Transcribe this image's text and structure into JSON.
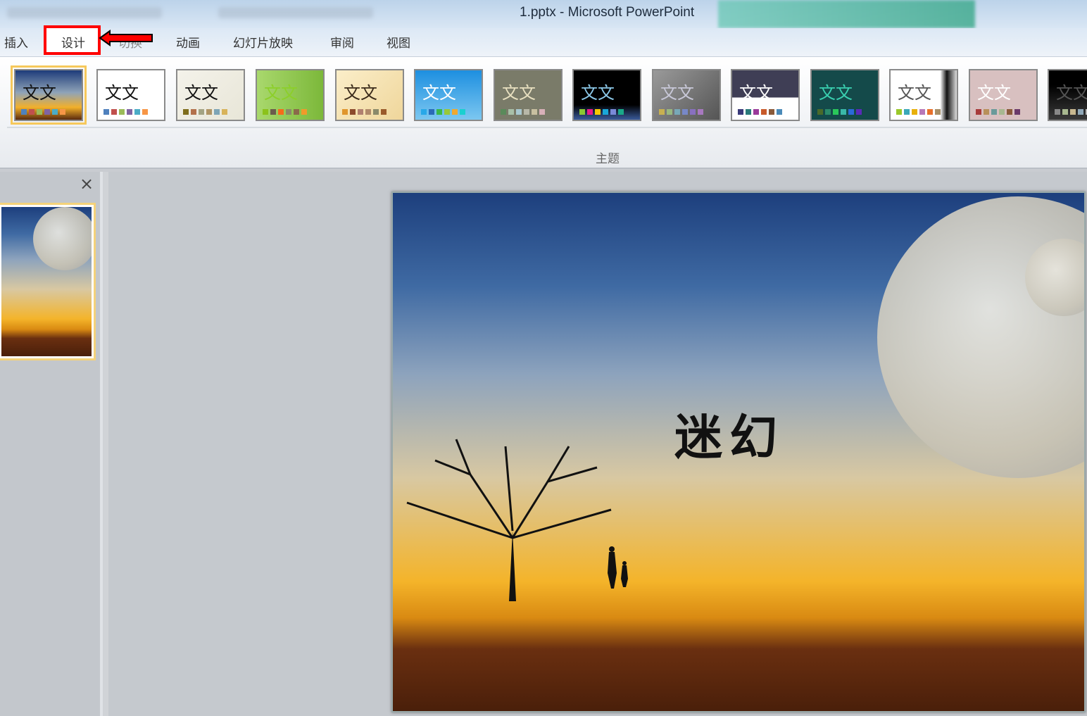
{
  "window": {
    "title": "1.pptx  -  Microsoft PowerPoint"
  },
  "tabs": [
    {
      "label": "插入"
    },
    {
      "label": "设计",
      "active": true
    },
    {
      "label": "切换"
    },
    {
      "label": "动画"
    },
    {
      "label": "幻灯片放映"
    },
    {
      "label": "审阅"
    },
    {
      "label": "视图"
    }
  ],
  "annotation": {
    "highlight_color": "#ff0000"
  },
  "themes": {
    "group_label": "主题",
    "items": [
      {
        "sample": "文文",
        "bg": "linear-gradient(#1e3c7a,#8fa3b8 45%,#f2b02a 75%,#5a2a0e)",
        "color": "#111",
        "swatches": [
          "#4f81bd",
          "#c0504d",
          "#9bbb59",
          "#8064a2",
          "#4bacc6",
          "#f79646"
        ],
        "selected": true
      },
      {
        "sample": "文文",
        "bg": "#fff",
        "color": "#111",
        "swatches": [
          "#4f81bd",
          "#c0504d",
          "#9bbb59",
          "#8064a2",
          "#4bacc6",
          "#f79646"
        ]
      },
      {
        "sample": "文文",
        "bg": "linear-gradient(135deg,#f4f2ea,#e8e6d8)",
        "color": "#111",
        "swatches": [
          "#7f6d1c",
          "#b3714b",
          "#a3a383",
          "#b09565",
          "#7ea5b6",
          "#d8b35a"
        ]
      },
      {
        "sample": "文文",
        "bg": "linear-gradient(90deg,#a9d86d,#7cb83a)",
        "color": "#8ccf2a",
        "swatches": [
          "#8bc21a",
          "#6b5c4c",
          "#f56b1a",
          "#8a8a6a",
          "#8a6a4a",
          "#f19a2a"
        ]
      },
      {
        "sample": "文文",
        "bg": "linear-gradient(135deg,#fbeec9,#efd69b)",
        "color": "#3a2a1a",
        "swatches": [
          "#e0962c",
          "#8c4a2c",
          "#b08070",
          "#b08a6a",
          "#8a8a6a",
          "#9a5a2a"
        ]
      },
      {
        "sample": "文文",
        "bg": "linear-gradient(#1d8fe0,#7cc7f0)",
        "color": "#fff",
        "swatches": [
          "#28a8e8",
          "#2a6ab8",
          "#3ab84a",
          "#98c83a",
          "#f0a830",
          "#1ad0d0"
        ]
      },
      {
        "sample": "文文",
        "bg": "#7a7b69",
        "color": "#e8e0c0",
        "swatches": [
          "#5a8a5a",
          "#a8c0a8",
          "#a8c8d0",
          "#b8b8a8",
          "#c8c0a0",
          "#d8b0b8"
        ]
      },
      {
        "sample": "文文",
        "bg": "linear-gradient(#000 70%,#3a5a9a)",
        "color": "#8cc8e8",
        "swatches": [
          "#8ac832",
          "#e81a8a",
          "#f8c800",
          "#1aa8d8",
          "#7a8ad8",
          "#1aa888"
        ]
      },
      {
        "sample": "文文",
        "bg": "linear-gradient(135deg,#9a9a9a,#555)",
        "color": "#c8c8d8",
        "swatches": [
          "#c8b050",
          "#98b880",
          "#78a8b8",
          "#7888c8",
          "#8870c0",
          "#a878c0"
        ]
      },
      {
        "sample": "文文",
        "bg": "linear-gradient(#3f3e55 55%,#fff 55%)",
        "color": "#fff",
        "swatches": [
          "#3a3a7a",
          "#2a7a7a",
          "#9a3a9a",
          "#c85a2a",
          "#8a5a3a",
          "#4a8ab8"
        ]
      },
      {
        "sample": "文文",
        "bg": "#144a4a",
        "color": "#3ad0b0",
        "swatches": [
          "#4a6a2a",
          "#2a8a6a",
          "#2ac85a",
          "#3ab8a8",
          "#2a6ad8",
          "#5a2ab8"
        ]
      },
      {
        "sample": "文文",
        "bg": "linear-gradient(90deg,#fff 75%,#111 85%,#ddd)",
        "color": "#555",
        "swatches": [
          "#9ac82a",
          "#3aa8b8",
          "#e8b00a",
          "#b878b8",
          "#e8702a",
          "#a89068"
        ]
      },
      {
        "sample": "文文",
        "bg": "#d8c0c0",
        "color": "#fff",
        "swatches": [
          "#a83a3a",
          "#b8905a",
          "#6a9a9a",
          "#a8b890",
          "#8a5a3a",
          "#6a3a6a"
        ]
      },
      {
        "sample": "文文",
        "bg": "linear-gradient(#000 30%,#3a3a3a)",
        "color": "#555",
        "swatches": [
          "#888",
          "#a8b890",
          "#c8b890",
          "#90a8b8",
          "#b8b8b8",
          "#a8a8a8"
        ]
      }
    ]
  },
  "slides_panel": {
    "close_icon": "×"
  },
  "slide": {
    "title": "迷幻"
  }
}
